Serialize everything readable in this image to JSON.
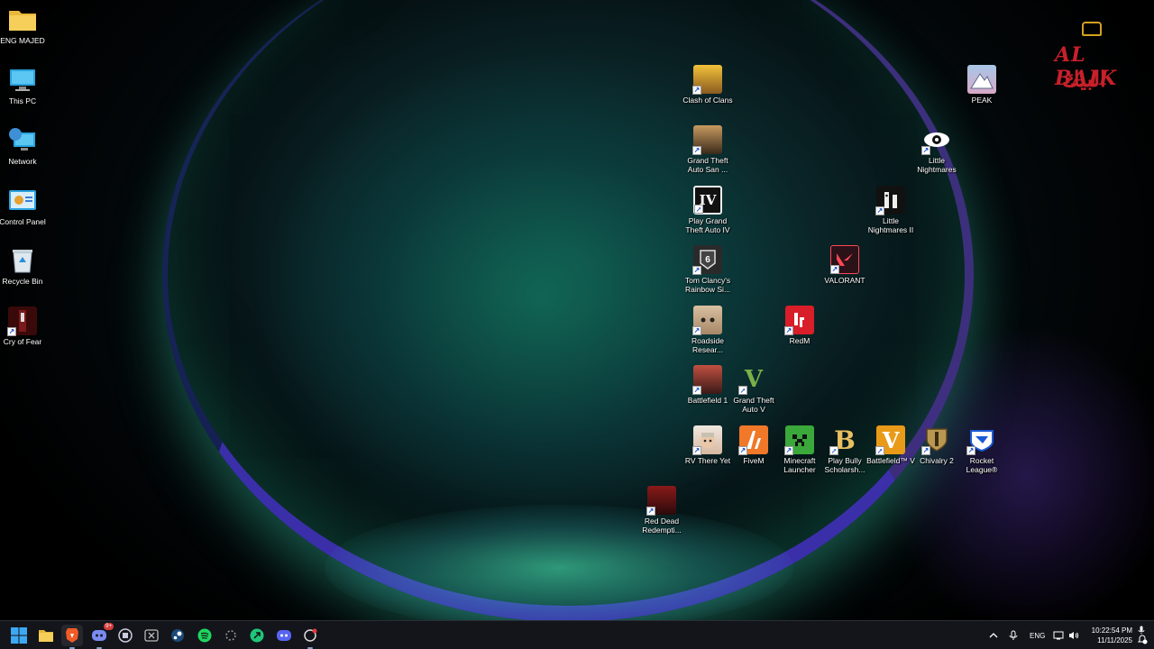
{
  "desktop": {
    "left_icons": [
      {
        "label": "ENG MAJED",
        "icon": "folder-icon"
      },
      {
        "label": "This PC",
        "icon": "monitor-icon"
      },
      {
        "label": "Network",
        "icon": "network-icon"
      },
      {
        "label": "Control Panel",
        "icon": "control-panel-icon"
      },
      {
        "label": "Recycle Bin",
        "icon": "recycle-bin-icon"
      },
      {
        "label": "Cry of Fear",
        "icon": "cry-of-fear-icon"
      }
    ],
    "game_icons": [
      {
        "label": "Clash of Clans"
      },
      {
        "label": "Grand Theft Auto San ..."
      },
      {
        "label": "Play Grand Theft Auto IV"
      },
      {
        "label": "Tom Clancy's Rainbow Si..."
      },
      {
        "label": "Roadside Resear..."
      },
      {
        "label": "Battlefield 1"
      },
      {
        "label": "Grand Theft Auto V"
      },
      {
        "label": "RV There Yet"
      },
      {
        "label": "FiveM"
      },
      {
        "label": "Minecraft Launcher"
      },
      {
        "label": "Play Bully Scholarsh..."
      },
      {
        "label": "Battlefield™ V"
      },
      {
        "label": "Chivalry 2"
      },
      {
        "label": "Rocket League®"
      },
      {
        "label": "Red Dead Redempti..."
      },
      {
        "label": "RedM"
      },
      {
        "label": "VALORANT"
      },
      {
        "label": "Little Nightmares II"
      },
      {
        "label": "Little Nightmares"
      },
      {
        "label": "PEAK"
      }
    ],
    "logo": {
      "line1": "AL BAIK",
      "line2": "البيك"
    }
  },
  "taskbar": {
    "apps": [
      {
        "name": "start-button",
        "icon": "windows-icon"
      },
      {
        "name": "file-explorer",
        "icon": "folder-icon"
      },
      {
        "name": "brave",
        "icon": "brave-icon"
      },
      {
        "name": "discord-ptb",
        "icon": "discord-icon",
        "badge": "9+"
      },
      {
        "name": "app-5",
        "icon": "app-icon"
      },
      {
        "name": "xbox",
        "icon": "xbox-icon"
      },
      {
        "name": "steam",
        "icon": "steam-icon"
      },
      {
        "name": "spotify",
        "icon": "spotify-icon"
      },
      {
        "name": "app-9",
        "icon": "app-icon"
      },
      {
        "name": "app-10",
        "icon": "app-icon"
      },
      {
        "name": "discord",
        "icon": "discord-icon"
      },
      {
        "name": "app-12",
        "icon": "app-icon"
      }
    ],
    "tray": {
      "language": "ENG",
      "time": "10:22:54 PM",
      "date": "11/11/2025"
    }
  }
}
